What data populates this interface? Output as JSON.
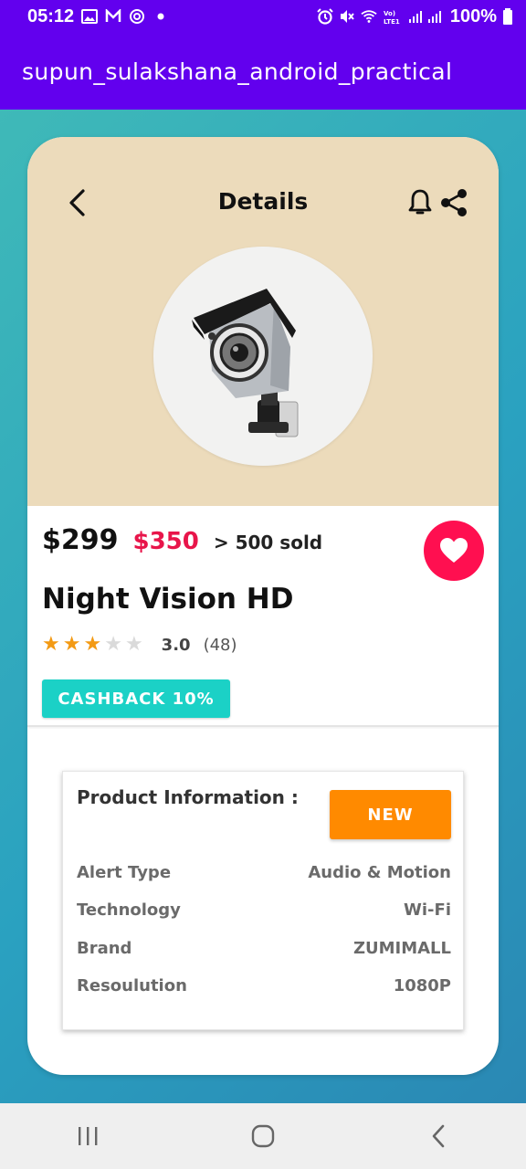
{
  "status_bar": {
    "time": "05:12",
    "battery": "100%",
    "left_icons": [
      "gallery-icon",
      "mail-icon",
      "sync-icon",
      "dot-icon"
    ],
    "right_icons": [
      "alarm-icon",
      "mute-icon",
      "wifi-icon",
      "volte-icon",
      "signal-icon",
      "battery-icon"
    ]
  },
  "app_bar": {
    "title": "supun_sulakshana_android_practical"
  },
  "header": {
    "title": "Details"
  },
  "product": {
    "price": "$299",
    "old_price": "$350",
    "sold": "> 500 sold",
    "name": "Night Vision HD",
    "rating": 3,
    "rating_max": 5,
    "rating_text": "3.0",
    "review_count": "(48)",
    "cashback_label": "CASHBACK 10%",
    "favorited": true
  },
  "product_info": {
    "heading": "Product Information :",
    "badge_label": "NEW",
    "rows": [
      {
        "label": "Alert Type",
        "value": "Audio & Motion"
      },
      {
        "label": "Technology",
        "value": "Wi-Fi"
      },
      {
        "label": "Brand",
        "value": "ZUMIMALL"
      },
      {
        "label": "Resoulution",
        "value": "1080P"
      }
    ]
  },
  "colors": {
    "app_bar": "#6200ee",
    "hero_bg": "#ecdbbb",
    "old_price": "#e8154a",
    "favorite": "#ff0f50",
    "cashback": "#1bd1c6",
    "new_badge": "#ff8a00",
    "star": "#f39a14"
  }
}
